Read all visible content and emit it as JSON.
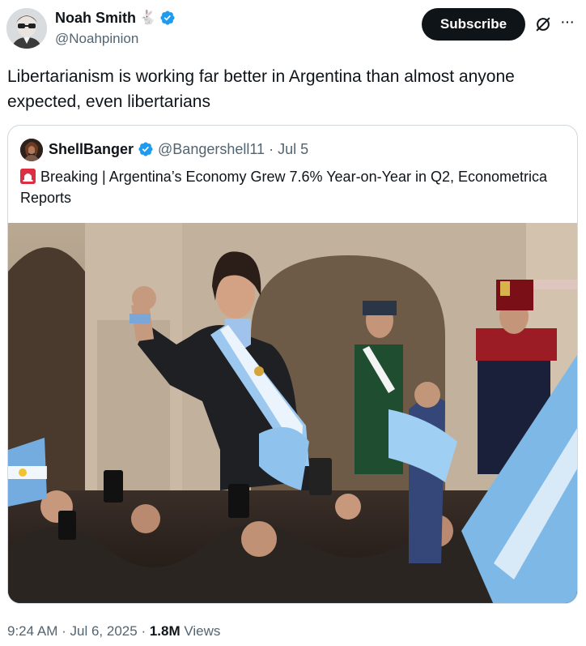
{
  "author": {
    "name": "Noah Smith",
    "name_emoji": "🐇",
    "handle": "@Noahpinion"
  },
  "subscribe_label": "Subscribe",
  "more_label": "···",
  "tweet_text": "Libertarianism is working far better in Argentina than almost anyone expected, even libertarians",
  "quoted": {
    "name": "ShellBanger",
    "handle": "@Bangershell11",
    "separator": "·",
    "date": "Jul 5",
    "text": "Breaking | Argentina’s Economy Grew 7.6% Year-on-Year in Q2, Econometrica Reports"
  },
  "footer": {
    "time": "9:24 AM",
    "sep1": "·",
    "date": "Jul 6, 2025",
    "sep2": "·",
    "views_count": "1.8M",
    "views_label": "Views"
  },
  "colors": {
    "verified": "#1d9bf0",
    "text": "#0f1419",
    "secondary": "#536471",
    "border": "#cfd9de",
    "flag_blue": "#74acdf"
  },
  "icons": [
    "verified-badge-icon",
    "rabbit-emoji",
    "grok-icon",
    "more-icon",
    "siren-emoji"
  ]
}
